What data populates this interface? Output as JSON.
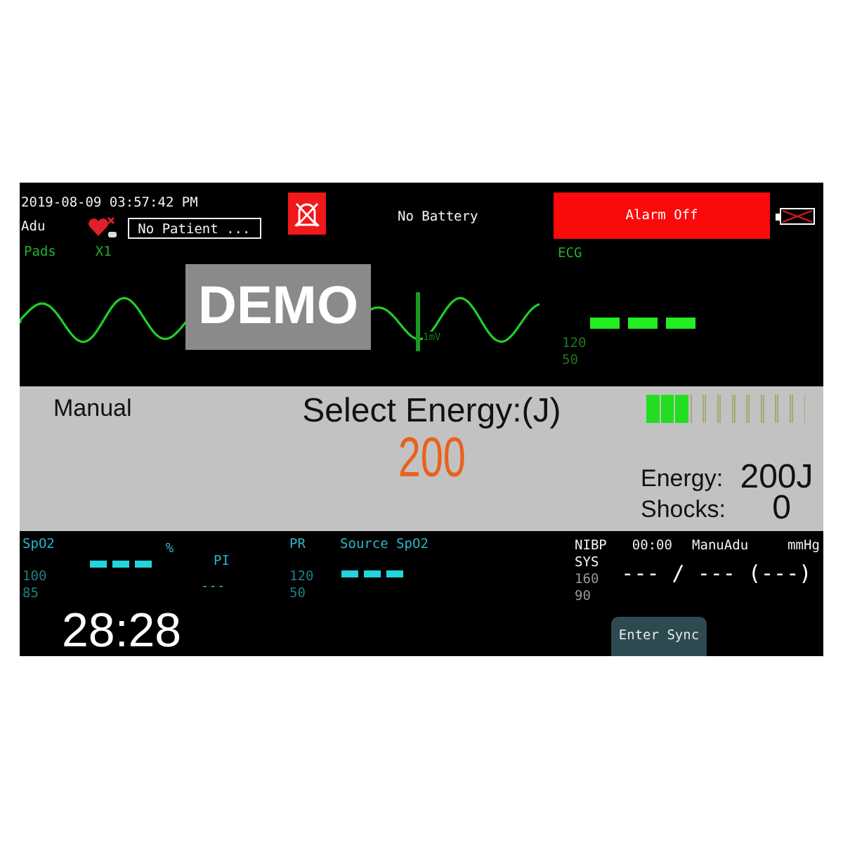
{
  "header": {
    "timestamp": "2019-08-09 03:57:42 PM",
    "patient_type": "Adu",
    "patient_name": "No Patient ...",
    "battery_status": "No Battery",
    "alarm_banner": "Alarm Off"
  },
  "waveform": {
    "source": "Pads",
    "gain": "X1",
    "scale": "1mV",
    "overlay": "DEMO"
  },
  "ecg": {
    "label": "ECG",
    "upper_limit": "120",
    "lower_limit": "50"
  },
  "energy_panel": {
    "mode": "Manual",
    "title": "Select Energy:(J)",
    "selected_value": "200",
    "charge": {
      "level": 0.27
    },
    "energy_label": "Energy:",
    "energy_value": "200J",
    "shocks_label": "Shocks:",
    "shocks_value": "0"
  },
  "spo2": {
    "label": "SpO2",
    "unit": "%",
    "upper_limit": "100",
    "lower_limit": "85"
  },
  "pi": {
    "label": "PI",
    "value": "---"
  },
  "pr": {
    "label": "PR",
    "upper_limit": "120",
    "lower_limit": "50",
    "source": "Source SpO2"
  },
  "timer": "28:28",
  "nibp": {
    "label": "NIBP",
    "time": "00:00",
    "mode": "ManuAdu",
    "unit": "mmHg",
    "sys_label": "SYS",
    "upper_limit": "160",
    "lower_limit": "90",
    "reading": "--- / --- (---)"
  },
  "buttons": [
    {
      "label": "Enter Sync"
    }
  ]
}
